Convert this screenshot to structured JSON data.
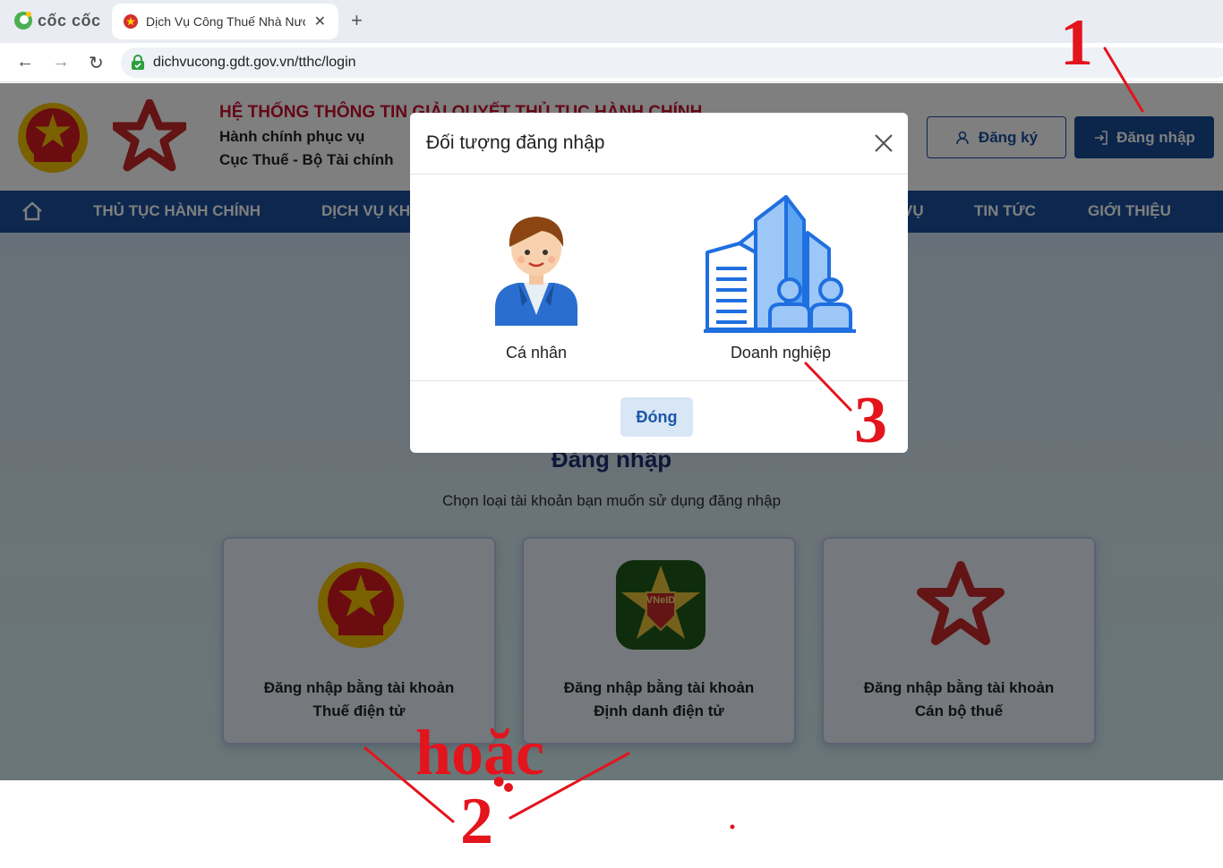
{
  "browser": {
    "brand": "cốc cốc",
    "tab_title": "Dịch Vụ Công Thuế Nhà Nước",
    "url": "dichvucong.gdt.gov.vn/tthc/login"
  },
  "header": {
    "title": "HỆ THỐNG THÔNG TIN GIẢI QUYẾT THỦ TỤC HÀNH CHÍNH",
    "subtitle1": "Hành chính phục vụ",
    "subtitle2": "Cục Thuế - Bộ Tài chính",
    "register_label": "Đăng ký",
    "login_label": "Đăng nhập"
  },
  "nav": {
    "items": [
      "THỦ TỤC HÀNH CHÍNH",
      "DỊCH VỤ KH",
      "VỤ",
      "TIN TỨC",
      "GIỚI THIỆU"
    ]
  },
  "main": {
    "heading": "Đăng nhập",
    "subheading": "Chọn loại tài khoản bạn muốn sử dụng đăng nhập",
    "cards": [
      {
        "line1": "Đăng nhập bằng tài khoản",
        "line2": "Thuế điện tử"
      },
      {
        "line1": "Đăng nhập bằng tài khoản",
        "line2": "Định danh điện tử"
      },
      {
        "line1": "Đăng nhập bằng tài khoản",
        "line2": "Cán bộ thuế"
      }
    ],
    "vneid_text": "VNeID"
  },
  "modal": {
    "title": "Đối tượng đăng nhập",
    "option_individual": "Cá nhân",
    "option_business": "Doanh nghiệp",
    "close_label": "Đóng"
  },
  "annotations": {
    "step1": "1",
    "step2": "2",
    "step3": "3",
    "or_text": "hoặc"
  },
  "colors": {
    "primary": "#1b4f9c",
    "accent_red": "#c8102e",
    "annotation": "#e3141c"
  }
}
